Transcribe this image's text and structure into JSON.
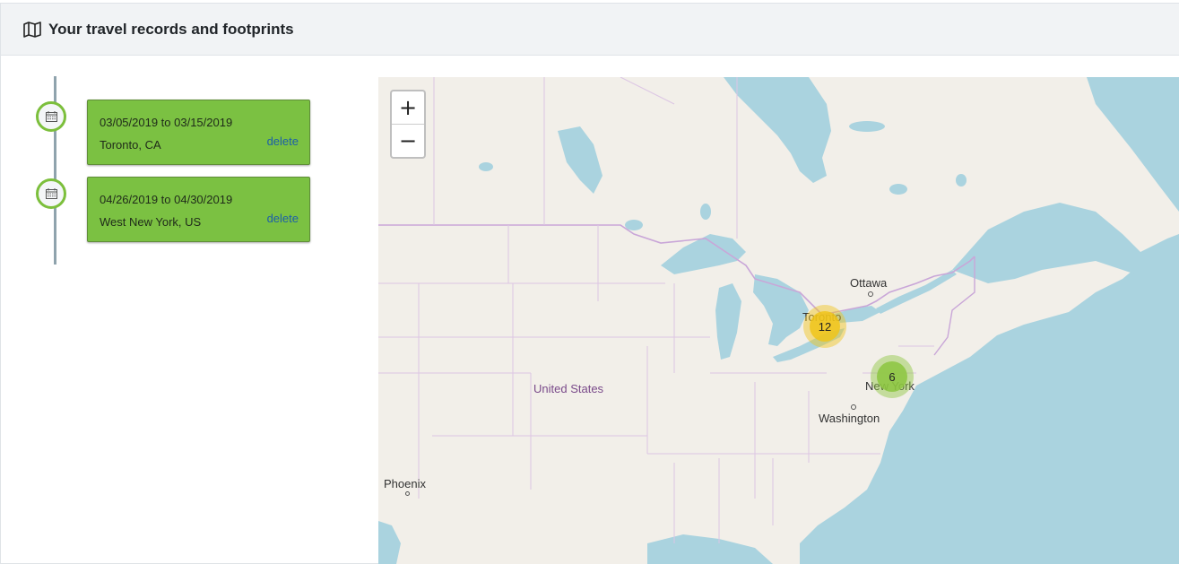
{
  "header": {
    "title": "Your travel records and footprints",
    "icon": "map-icon"
  },
  "trips": [
    {
      "dates": "03/05/2019 to 03/15/2019",
      "place": "Toronto, CA",
      "delete_label": "delete"
    },
    {
      "dates": "04/26/2019 to 04/30/2019",
      "place": "West New York, US",
      "delete_label": "delete"
    }
  ],
  "map": {
    "zoom_in": "+",
    "zoom_out": "−",
    "labels": {
      "ottawa": "Ottawa",
      "toronto": "Toronto",
      "new_york": "New York",
      "washington": "Washington",
      "united_states": "United States",
      "phoenix": "Phoenix"
    },
    "clusters": [
      {
        "count": "12",
        "color": "#f0c419"
      },
      {
        "count": "6",
        "color": "#8cc63f"
      }
    ]
  },
  "colors": {
    "card_green": "#7bc142",
    "water": "#aad3df",
    "land": "#f2efe9",
    "border": "#c9a6d8"
  }
}
